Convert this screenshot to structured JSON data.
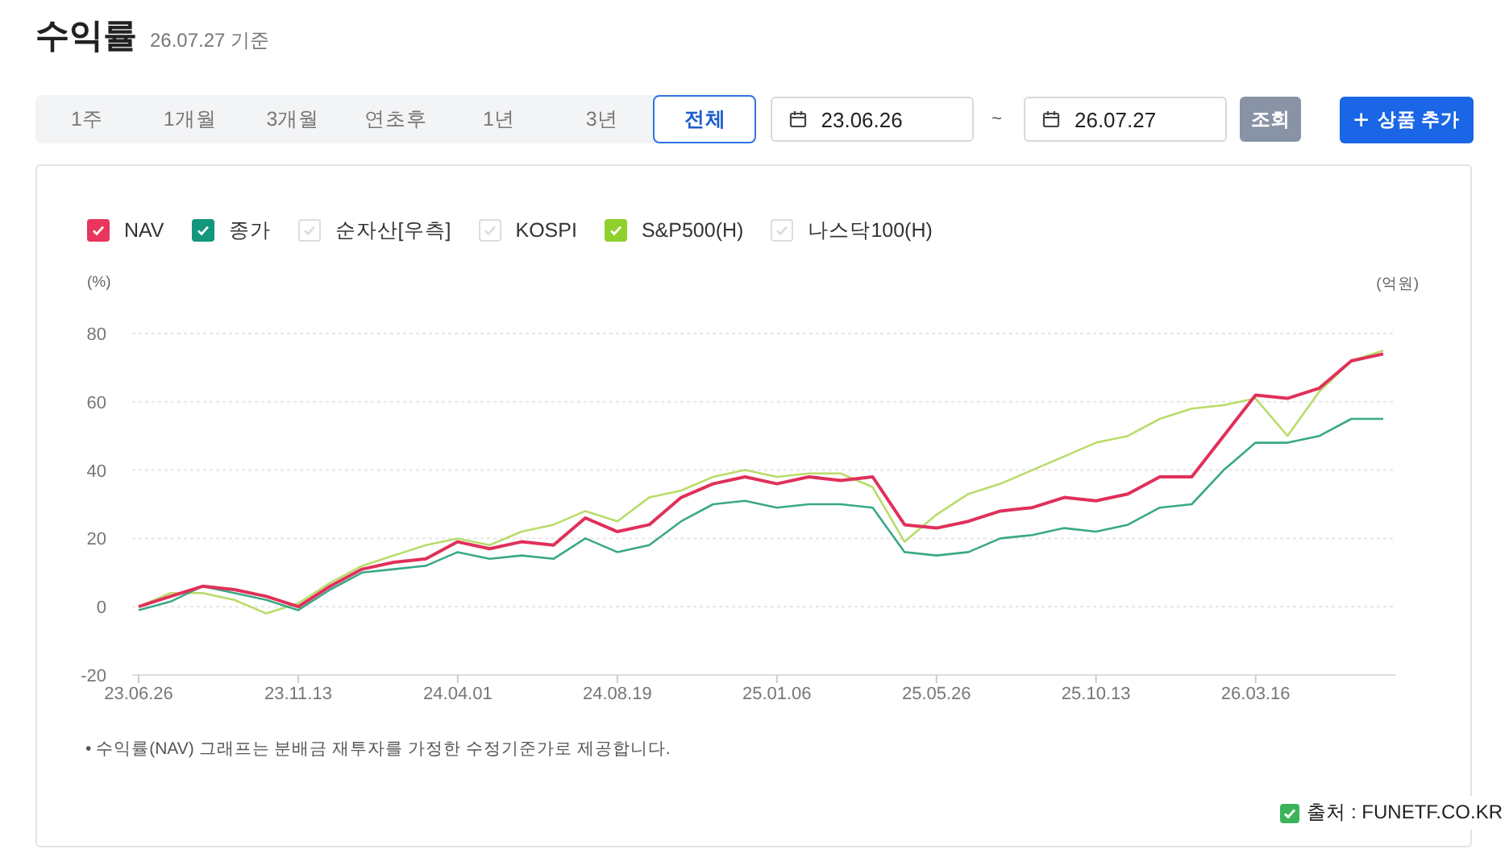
{
  "header": {
    "title": "수익률",
    "as_of": "26.07.27 기준"
  },
  "period_tabs": [
    {
      "label": "1주",
      "selected": false
    },
    {
      "label": "1개월",
      "selected": false
    },
    {
      "label": "3개월",
      "selected": false
    },
    {
      "label": "연초후",
      "selected": false
    },
    {
      "label": "1년",
      "selected": false
    },
    {
      "label": "3년",
      "selected": false
    },
    {
      "label": "전체",
      "selected": true
    }
  ],
  "date_range": {
    "start": "23.06.26",
    "separator": "~",
    "end": "26.07.27"
  },
  "buttons": {
    "query": "조회",
    "add_product": "상품 추가",
    "add_icon": "+"
  },
  "legend": [
    {
      "kind": "series",
      "checked": true,
      "color": "#e8365d"
    },
    {
      "kind": "series",
      "checked": true,
      "color": "#13967c"
    },
    {
      "kind": "toggle",
      "label": "순자산[우측]",
      "checked": false
    },
    {
      "kind": "toggle",
      "label": "KOSPI",
      "checked": false
    },
    {
      "kind": "series",
      "checked": true,
      "color": "#8fd12c"
    },
    {
      "kind": "toggle",
      "label": "나스닥100(H)",
      "checked": false
    }
  ],
  "chart": {
    "left_unit": "(%)",
    "right_unit": "(억원)",
    "chart_data": {
      "type": "line",
      "categories": [
        "23.06.26",
        null,
        null,
        null,
        null,
        "23.11.13",
        null,
        null,
        null,
        null,
        "24.04.01",
        null,
        null,
        null,
        null,
        "24.08.19",
        null,
        null,
        null,
        null,
        "25.01.06",
        null,
        null,
        null,
        null,
        "25.05.26",
        null,
        null,
        null,
        null,
        "25.10.13",
        null,
        null,
        null,
        null,
        "26.03.16",
        null,
        null,
        null,
        null
      ],
      "series": [
        {
          "name": "NAV",
          "color": "#e0305a",
          "values": [
            0,
            3,
            6,
            5,
            3,
            0,
            6,
            11,
            13,
            14,
            19,
            17,
            19,
            18,
            26,
            22,
            24,
            32,
            36,
            38,
            36,
            38,
            37,
            38,
            24,
            23,
            25,
            28,
            29,
            32,
            31,
            33,
            38,
            38,
            50,
            62,
            61,
            64,
            72,
            74
          ]
        },
        {
          "name": "종가",
          "color": "#3aa889",
          "values": [
            -1,
            1.5,
            6,
            4,
            2,
            -1,
            5,
            10,
            11,
            12,
            16,
            14,
            15,
            14,
            20,
            16,
            18,
            25,
            30,
            31,
            29,
            30,
            30,
            29,
            16,
            15,
            16,
            20,
            21,
            23,
            22,
            24,
            29,
            30,
            40,
            48,
            48,
            50,
            55,
            55
          ]
        },
        {
          "name": "S&P500(H)",
          "color": "#b9dc6a",
          "values": [
            0,
            4,
            4,
            2,
            -2,
            1,
            7,
            12,
            15,
            18,
            20,
            18,
            22,
            24,
            28,
            25,
            32,
            34,
            38,
            40,
            38,
            39,
            39,
            35,
            19,
            27,
            33,
            36,
            40,
            44,
            48,
            50,
            55,
            58,
            59,
            61,
            50,
            63,
            72,
            75
          ]
        }
      ],
      "ylim": [
        -20,
        80
      ],
      "grid": true,
      "yticks": [
        -20,
        0,
        20,
        40,
        60,
        80
      ]
    }
  },
  "footnote": "• 수익률(NAV) 그래프는 분배금 재투자를 가정한 수정기준가로 제공합니다.",
  "source": "출처 : FUNETF.CO.KR"
}
